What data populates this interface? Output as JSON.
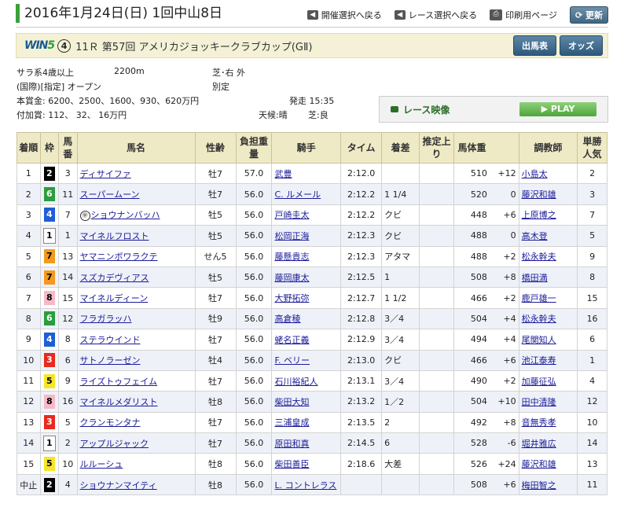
{
  "header": {
    "title": "2016年1月24日(日) 1回中山8日",
    "link_schedule": "開催選択へ戻る",
    "link_race": "レース選択へ戻る",
    "link_print": "印刷用ページ",
    "reload": "更新"
  },
  "race": {
    "logo_win": "WIN",
    "logo_5": "5",
    "win5_no": "④",
    "name": "11Ｒ 第57回 アメリカジョッキークラブカップ(GⅡ)",
    "btn_card": "出馬表",
    "btn_odds": "オッズ"
  },
  "info": {
    "cls": "サラ系4歳以上",
    "distance": "2200m",
    "course": "芝･右 外",
    "cond": "(国際)[指定] オープン",
    "weight_rule": "別定",
    "prize": "本賞金:  6200、2500、1600、930、620万円",
    "added": "付加賞:    112、  32、  16万円",
    "post": "発走 15:35",
    "weather": "天候:晴",
    "going": "芝:良"
  },
  "video": {
    "label": "レース映像",
    "play": "PLAY"
  },
  "columns": [
    "着順",
    "枠",
    "馬番",
    "馬名",
    "性齢",
    "負担重量",
    "騎手",
    "タイム",
    "着差",
    "推定上り",
    "馬体重",
    "",
    "調教師",
    "単勝人気"
  ],
  "rows": [
    {
      "pos": "1",
      "waku": "2",
      "num": "3",
      "horse": "ディサイファ",
      "mark": "",
      "sex": "牡7",
      "wt": "57.0",
      "jockey": "武豊",
      "time": "2:12.0",
      "margin": "",
      "l3f": "",
      "bw": "510",
      "bwd": "+12",
      "trainer": "小島太",
      "pop": "2"
    },
    {
      "pos": "2",
      "waku": "6",
      "num": "11",
      "horse": "スーパームーン",
      "mark": "",
      "sex": "牡7",
      "wt": "56.0",
      "jockey": "C. ルメール",
      "time": "2:12.2",
      "margin": "1 1/4",
      "l3f": "",
      "bw": "520",
      "bwd": "0",
      "trainer": "藤沢和雄",
      "pop": "3"
    },
    {
      "pos": "3",
      "waku": "4",
      "num": "7",
      "horse": "ショウナンバッハ",
      "mark": "㊫",
      "sex": "牡5",
      "wt": "56.0",
      "jockey": "戸崎圭太",
      "time": "2:12.2",
      "margin": "クビ",
      "l3f": "",
      "bw": "448",
      "bwd": "+6",
      "trainer": "上原博之",
      "pop": "7"
    },
    {
      "pos": "4",
      "waku": "1",
      "num": "1",
      "horse": "マイネルフロスト",
      "mark": "",
      "sex": "牡5",
      "wt": "56.0",
      "jockey": "松岡正海",
      "time": "2:12.3",
      "margin": "クビ",
      "l3f": "",
      "bw": "488",
      "bwd": "0",
      "trainer": "高木登",
      "pop": "5"
    },
    {
      "pos": "5",
      "waku": "7",
      "num": "13",
      "horse": "ヤマニンボワラクテ",
      "mark": "",
      "sex": "せん5",
      "wt": "56.0",
      "jockey": "藤懸貴志",
      "time": "2:12.3",
      "margin": "アタマ",
      "l3f": "",
      "bw": "488",
      "bwd": "+2",
      "trainer": "松永幹夫",
      "pop": "9"
    },
    {
      "pos": "6",
      "waku": "7",
      "num": "14",
      "horse": "スズカデヴィアス",
      "mark": "",
      "sex": "牡5",
      "wt": "56.0",
      "jockey": "藤岡康太",
      "time": "2:12.5",
      "margin": "1",
      "l3f": "",
      "bw": "508",
      "bwd": "+8",
      "trainer": "橋田満",
      "pop": "8"
    },
    {
      "pos": "7",
      "waku": "8",
      "num": "15",
      "horse": "マイネルディーン",
      "mark": "",
      "sex": "牡7",
      "wt": "56.0",
      "jockey": "大野拓弥",
      "time": "2:12.7",
      "margin": "1 1/2",
      "l3f": "",
      "bw": "466",
      "bwd": "+2",
      "trainer": "鹿戸雄一",
      "pop": "15"
    },
    {
      "pos": "8",
      "waku": "6",
      "num": "12",
      "horse": "フラガラッハ",
      "mark": "",
      "sex": "牡9",
      "wt": "56.0",
      "jockey": "高倉稜",
      "time": "2:12.8",
      "margin": "3／4",
      "l3f": "",
      "bw": "504",
      "bwd": "+4",
      "trainer": "松永幹夫",
      "pop": "16"
    },
    {
      "pos": "9",
      "waku": "4",
      "num": "8",
      "horse": "ステラウインド",
      "mark": "",
      "sex": "牡7",
      "wt": "56.0",
      "jockey": "蛯名正義",
      "time": "2:12.9",
      "margin": "3／4",
      "l3f": "",
      "bw": "494",
      "bwd": "+4",
      "trainer": "尾関知人",
      "pop": "6"
    },
    {
      "pos": "10",
      "waku": "3",
      "num": "6",
      "horse": "サトノラーゼン",
      "mark": "",
      "sex": "牡4",
      "wt": "56.0",
      "jockey": "F. ベリー",
      "time": "2:13.0",
      "margin": "クビ",
      "l3f": "",
      "bw": "466",
      "bwd": "+6",
      "trainer": "池江泰寿",
      "pop": "1"
    },
    {
      "pos": "11",
      "waku": "5",
      "num": "9",
      "horse": "ライズトゥフェイム",
      "mark": "",
      "sex": "牡7",
      "wt": "56.0",
      "jockey": "石川裕紀人",
      "time": "2:13.1",
      "margin": "3／4",
      "l3f": "",
      "bw": "490",
      "bwd": "+2",
      "trainer": "加藤征弘",
      "pop": "4"
    },
    {
      "pos": "12",
      "waku": "8",
      "num": "16",
      "horse": "マイネルメダリスト",
      "mark": "",
      "sex": "牡8",
      "wt": "56.0",
      "jockey": "柴田大知",
      "time": "2:13.2",
      "margin": "1／2",
      "l3f": "",
      "bw": "504",
      "bwd": "+10",
      "trainer": "田中清隆",
      "pop": "12"
    },
    {
      "pos": "13",
      "waku": "3",
      "num": "5",
      "horse": "クランモンタナ",
      "mark": "",
      "sex": "牡7",
      "wt": "56.0",
      "jockey": "三浦皇成",
      "time": "2:13.5",
      "margin": "2",
      "l3f": "",
      "bw": "492",
      "bwd": "+8",
      "trainer": "音無秀孝",
      "pop": "10"
    },
    {
      "pos": "14",
      "waku": "1",
      "num": "2",
      "horse": "アップルジャック",
      "mark": "",
      "sex": "牡7",
      "wt": "56.0",
      "jockey": "原田和真",
      "time": "2:14.5",
      "margin": "6",
      "l3f": "",
      "bw": "528",
      "bwd": "-6",
      "trainer": "堀井雅広",
      "pop": "14"
    },
    {
      "pos": "15",
      "waku": "5",
      "num": "10",
      "horse": "ルルーシュ",
      "mark": "",
      "sex": "牡8",
      "wt": "56.0",
      "jockey": "柴田善臣",
      "time": "2:18.6",
      "margin": "大差",
      "l3f": "",
      "bw": "526",
      "bwd": "+24",
      "trainer": "藤沢和雄",
      "pop": "13"
    },
    {
      "pos": "中止",
      "waku": "2",
      "num": "4",
      "horse": "ショウナンマイティ",
      "mark": "",
      "sex": "牡8",
      "wt": "56.0",
      "jockey": "L. コントレラス",
      "time": "",
      "margin": "",
      "l3f": "",
      "bw": "508",
      "bwd": "+6",
      "trainer": "梅田智之",
      "pop": "11"
    }
  ]
}
